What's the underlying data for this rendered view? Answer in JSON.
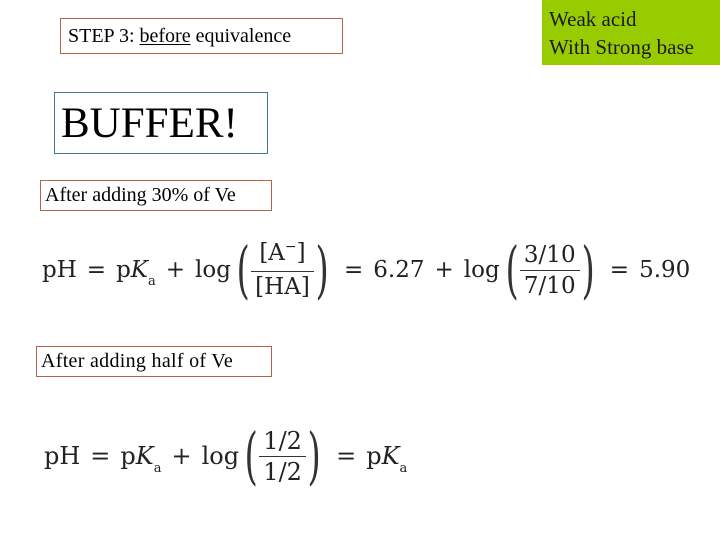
{
  "header": {
    "step_prefix": "STEP 3: ",
    "step_emphasis": "before",
    "step_suffix": " equivalence"
  },
  "topic": {
    "line1": "Weak acid",
    "line2": "With Strong base",
    "color": "#99cc00"
  },
  "buffer_label": "BUFFER!",
  "section1": {
    "label": "After adding 30% of Ve",
    "equation": {
      "lhs": "pH",
      "eq": "=",
      "pka_p": "p",
      "pka_K": "K",
      "pka_sub": "a",
      "plus": "+",
      "log": "log",
      "frac1_num_open": "[A",
      "frac1_num_sup": "−",
      "frac1_num_close": "]",
      "frac1_den": "[HA]",
      "pka_value": "6.27",
      "frac2_num": "3/10",
      "frac2_den": "7/10",
      "result": "5.90"
    }
  },
  "section2": {
    "label": "After adding half of Ve",
    "equation": {
      "lhs": "pH",
      "eq": "=",
      "pka_p": "p",
      "pka_K": "K",
      "pka_sub": "a",
      "plus": "+",
      "log": "log",
      "frac_num": "1/2",
      "frac_den": "1/2",
      "result_p": "p",
      "result_K": "K",
      "result_sub": "a"
    }
  },
  "glyphs": {
    "lparen": "(",
    "rparen": ")"
  }
}
